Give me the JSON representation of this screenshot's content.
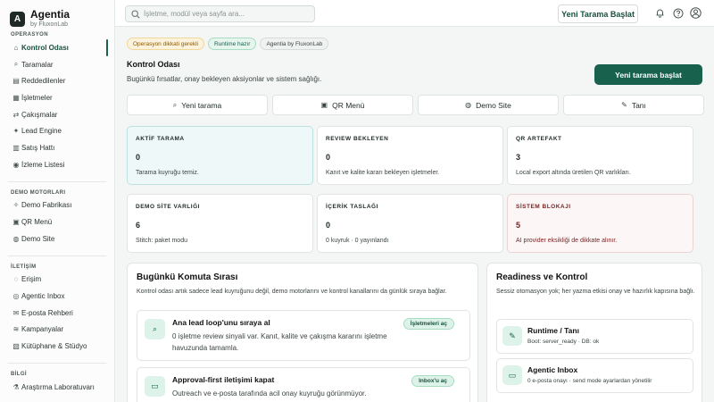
{
  "brand": {
    "name": "Agentia",
    "sub": "by FluxonLab",
    "logo": "A"
  },
  "sidebar": {
    "sections": [
      {
        "label": "OPERASYON",
        "items": [
          {
            "label": "Kontrol Odası",
            "icon": "home-icon",
            "glyph": "⌂",
            "active": true
          },
          {
            "label": "Taramalar",
            "icon": "search-icon",
            "glyph": "⌕"
          },
          {
            "label": "Reddedilenler",
            "icon": "archive-icon",
            "glyph": "▤"
          },
          {
            "label": "İşletmeler",
            "icon": "building-icon",
            "glyph": "▦"
          },
          {
            "label": "Çakışmalar",
            "icon": "swap-icon",
            "glyph": "⇄"
          },
          {
            "label": "Lead Engine",
            "icon": "sparkle-icon",
            "glyph": "✦"
          },
          {
            "label": "Satış Hattı",
            "icon": "chart-icon",
            "glyph": "▥"
          },
          {
            "label": "İzleme Listesi",
            "icon": "eye-icon",
            "glyph": "◉"
          }
        ]
      },
      {
        "label": "DEMO MOTORLARI",
        "items": [
          {
            "label": "Demo Fabrikası",
            "icon": "magic-icon",
            "glyph": "✧"
          },
          {
            "label": "QR Menü",
            "icon": "qr-icon",
            "glyph": "▣"
          },
          {
            "label": "Demo Site",
            "icon": "globe-icon",
            "glyph": "◍"
          }
        ]
      },
      {
        "label": "İLETİŞİM",
        "items": [
          {
            "label": "Erişim",
            "icon": "chat-icon",
            "glyph": "◌"
          },
          {
            "label": "Agentic Inbox",
            "icon": "bot-icon",
            "glyph": "◎"
          },
          {
            "label": "E-posta Rehberi",
            "icon": "mail-icon",
            "glyph": "✉"
          },
          {
            "label": "Kampanyalar",
            "icon": "layers-icon",
            "glyph": "≋"
          },
          {
            "label": "Kütüphane & Stüdyo",
            "icon": "book-icon",
            "glyph": "▧"
          }
        ]
      },
      {
        "label": "BİLGİ",
        "items": [
          {
            "label": "Araştırma Laboratuvarı",
            "icon": "flask-icon",
            "glyph": "⚗"
          }
        ]
      }
    ]
  },
  "topbar": {
    "search_placeholder": "İşletme, modül veya sayfa ara...",
    "new_scan_label": "Yeni Tarama Başlat"
  },
  "badges": [
    {
      "label": "Operasyon dikkati gerekli",
      "kind": "warn"
    },
    {
      "label": "Runtime hazır",
      "kind": "ok"
    },
    {
      "label": "Agentia by FluxonLab",
      "kind": "info"
    }
  ],
  "header": {
    "title": "Kontrol Odası",
    "subtitle": "Bugünkü fırsatlar, onay bekleyen aksiyonlar ve sistem sağlığı.",
    "primary_label": "Yeni tarama başlat"
  },
  "quick_actions": [
    {
      "label": "Yeni tarama",
      "icon": "search-icon",
      "glyph": "⌕"
    },
    {
      "label": "QR Menü",
      "icon": "qr-icon",
      "glyph": "▣"
    },
    {
      "label": "Demo Site",
      "icon": "globe-icon",
      "glyph": "◍"
    },
    {
      "label": "Tanı",
      "icon": "wrench-icon",
      "glyph": "✎"
    }
  ],
  "stats": [
    {
      "label": "AKTİF TARAMA",
      "value": "0",
      "desc": "Tarama kuyruğu temiz.",
      "tone": "hi"
    },
    {
      "label": "REVIEW BEKLEYEN",
      "value": "0",
      "desc": "Kanıt ve kalite kararı bekleyen işletmeler.",
      "tone": ""
    },
    {
      "label": "QR ARTEFAKT",
      "value": "3",
      "desc": "Local export altında üretilen QR varlıkları.",
      "tone": ""
    },
    {
      "label": "DEMO SİTE VARLIĞI",
      "value": "6",
      "desc": "Stitch: paket modu",
      "tone": ""
    },
    {
      "label": "İÇERİK TASLAĞI",
      "value": "0",
      "desc": "0 kuyruk · 0 yayınlandı",
      "tone": ""
    },
    {
      "label": "SİSTEM BLOKAJI",
      "value": "5",
      "desc": "AI provider eksikliği de dikkate alınır.",
      "tone": "danger"
    }
  ],
  "command_queue": {
    "title": "Bugünkü Komuta Sırası",
    "subtitle": "Kontrol odası artık sadece lead kuyruğunu değil, demo motorlarını ve kontrol kanallarını da günlük sıraya bağlar.",
    "tasks": [
      {
        "title": "Ana lead loop'unu sıraya al",
        "desc": "0 işletme review sinyali var. Kanıt, kalite ve çakışma kararını işletme havuzunda tamamla.",
        "button": "İşletmeleri aç",
        "icon": "search-icon",
        "glyph": "⌕"
      },
      {
        "title": "Approval-first iletişimi kapat",
        "desc": "Outreach ve e-posta tarafında acil onay kuyruğu görünmüyor.",
        "button": "Inbox'u aç",
        "icon": "inbox-icon",
        "glyph": "▭"
      }
    ]
  },
  "readiness": {
    "title": "Readiness ve Kontrol",
    "subtitle": "Sessiz otomasyon yok; her yazma etkisi onay ve hazırlık kapısına bağlı.",
    "items": [
      {
        "title": "Runtime / Tanı",
        "desc": "Boot: server_ready · DB: ok",
        "icon": "wrench-icon",
        "glyph": "✎"
      },
      {
        "title": "Agentic Inbox",
        "desc": "0 e-posta onayı · send mode ayarlardan yönetilir",
        "icon": "inbox-icon",
        "glyph": "▭"
      }
    ]
  }
}
